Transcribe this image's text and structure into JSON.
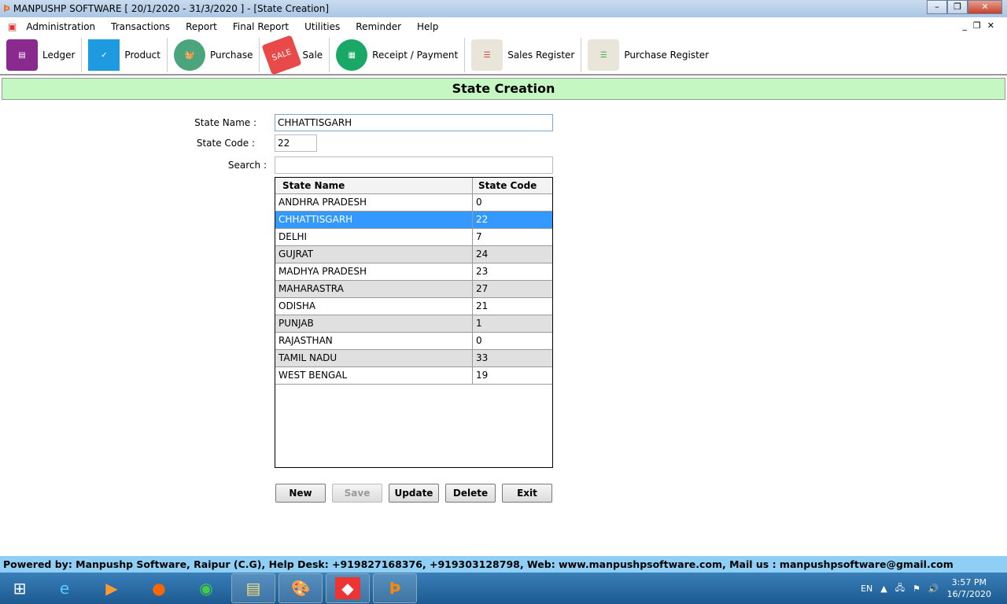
{
  "window": {
    "title": "MANPUSHP SOFTWARE [ 20/1/2020 - 31/3/2020 ]   - [State Creation]"
  },
  "menu": [
    "Administration",
    "Transactions",
    "Report",
    "Final Report",
    "Utilities",
    "Reminder",
    "Help"
  ],
  "toolbar": [
    {
      "label": "Ledger",
      "icon": "ledger-book-icon",
      "color": "#8b2a8e"
    },
    {
      "label": "Product",
      "icon": "products-icon",
      "color": "#1e9be0"
    },
    {
      "label": "Purchase",
      "icon": "basket-icon",
      "color": "#4aa57d"
    },
    {
      "label": "Sale",
      "icon": "sale-tag-icon",
      "color": "#e84a4a"
    },
    {
      "label": "Receipt / Payment",
      "icon": "receipt-icon",
      "color": "#1aa866"
    },
    {
      "label": "Sales Register",
      "icon": "register-icon",
      "color": "#e9e5d8"
    },
    {
      "label": "Purchase Register",
      "icon": "register-icon",
      "color": "#e9e5d8"
    }
  ],
  "form": {
    "title": "State Creation",
    "state_name_label": "State Name :",
    "state_name": "CHHATTISGARH",
    "state_code_label": "State Code :",
    "state_code": "22",
    "search_label": "Search :",
    "search": ""
  },
  "table": {
    "headers": [
      "State Name",
      "State Code"
    ],
    "rows": [
      [
        "ANDHRA PRADESH",
        "0"
      ],
      [
        "CHHATTISGARH",
        "22"
      ],
      [
        "DELHI",
        "7"
      ],
      [
        "GUJRAT",
        "24"
      ],
      [
        "MADHYA PRADESH",
        "23"
      ],
      [
        "MAHARASTRA",
        "27"
      ],
      [
        "ODISHA",
        "21"
      ],
      [
        "PUNJAB",
        "1"
      ],
      [
        "RAJASTHAN",
        "0"
      ],
      [
        "TAMIL NADU",
        "33"
      ],
      [
        "WEST BENGAL",
        "19"
      ]
    ],
    "selected": 1
  },
  "buttons": {
    "new": "New",
    "save": "Save",
    "update": "Update",
    "delete": "Delete",
    "exit": "Exit"
  },
  "footer": "Powered by: Manpushp Software, Raipur (C.G), Help Desk: +919827168376, +919303128798, Web: www.manpushpsoftware.com,  Mail us :  manpushpsoftware@gmail.com",
  "tray": {
    "lang": "EN",
    "time": "3:57 PM",
    "date": "16/7/2020"
  }
}
